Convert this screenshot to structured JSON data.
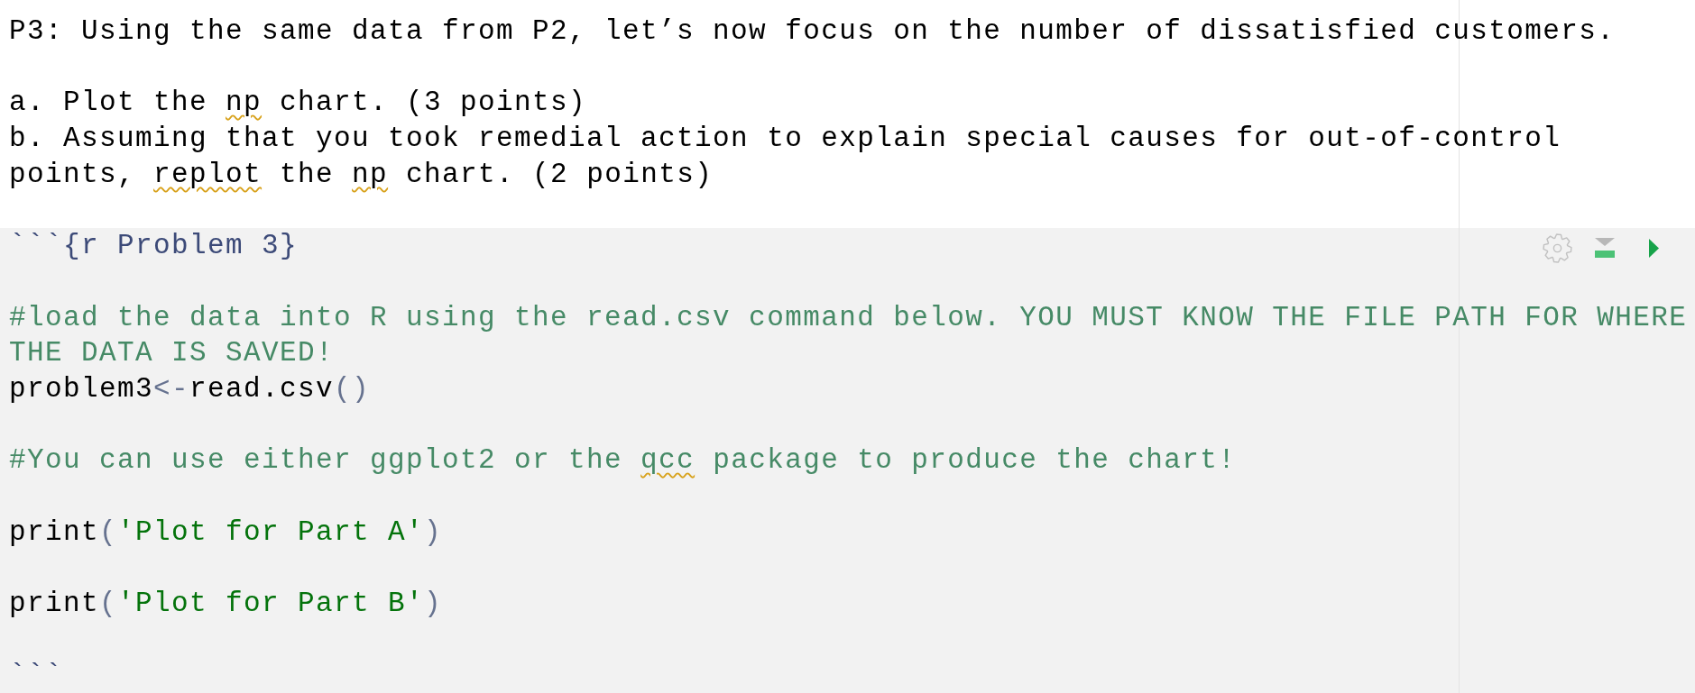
{
  "document": {
    "paragraphs": [
      {
        "lines": [
          {
            "segments": [
              {
                "text": "P3: Using the same data from P2, let’s now focus on the number of dissatisfied customers.",
                "flagged": false
              }
            ]
          }
        ]
      },
      {
        "lines": [
          {
            "segments": [
              {
                "text": "a. Plot the ",
                "flagged": false
              },
              {
                "text": "np",
                "flagged": true
              },
              {
                "text": " chart. (3 points)",
                "flagged": false
              }
            ]
          },
          {
            "segments": [
              {
                "text": "b. Assuming that you took remedial action to explain special causes for out-of-control points, ",
                "flagged": false
              },
              {
                "text": "replot",
                "flagged": true
              },
              {
                "text": " the ",
                "flagged": false
              },
              {
                "text": "np",
                "flagged": true
              },
              {
                "text": " chart. (2 points)",
                "flagged": false
              }
            ]
          }
        ]
      }
    ],
    "code_chunk": {
      "header": "```{r Problem 3}",
      "blocks": [
        {
          "lines": [
            {
              "tokens": [
                {
                  "text": "#load the data into R using the read.csv command below. YOU MUST KNOW THE FILE PATH FOR WHERE THE DATA IS SAVED!",
                  "kind": "comment",
                  "flagged": false
                }
              ]
            },
            {
              "tokens": [
                {
                  "text": "problem3",
                  "kind": "identifier",
                  "flagged": false
                },
                {
                  "text": "<-",
                  "kind": "operator",
                  "flagged": false
                },
                {
                  "text": "read.csv",
                  "kind": "identifier",
                  "flagged": false
                },
                {
                  "text": "()",
                  "kind": "paren",
                  "flagged": false
                }
              ]
            }
          ]
        },
        {
          "lines": [
            {
              "tokens": [
                {
                  "text": "#You can use either ggplot2 or the ",
                  "kind": "comment",
                  "flagged": false
                },
                {
                  "text": "qcc",
                  "kind": "comment",
                  "flagged": true
                },
                {
                  "text": " package to produce the chart!",
                  "kind": "comment",
                  "flagged": false
                }
              ]
            }
          ]
        },
        {
          "lines": [
            {
              "tokens": [
                {
                  "text": "print",
                  "kind": "identifier",
                  "flagged": false
                },
                {
                  "text": "(",
                  "kind": "paren",
                  "flagged": false
                },
                {
                  "text": "'Plot for Part A'",
                  "kind": "string",
                  "flagged": false
                },
                {
                  "text": ")",
                  "kind": "paren",
                  "flagged": false
                }
              ]
            }
          ]
        },
        {
          "lines": [
            {
              "tokens": [
                {
                  "text": "print",
                  "kind": "identifier",
                  "flagged": false
                },
                {
                  "text": "(",
                  "kind": "paren",
                  "flagged": false
                },
                {
                  "text": "'Plot for Part B'",
                  "kind": "string",
                  "flagged": false
                },
                {
                  "text": ")",
                  "kind": "paren",
                  "flagged": false
                }
              ]
            }
          ]
        }
      ],
      "footer": "```"
    }
  }
}
